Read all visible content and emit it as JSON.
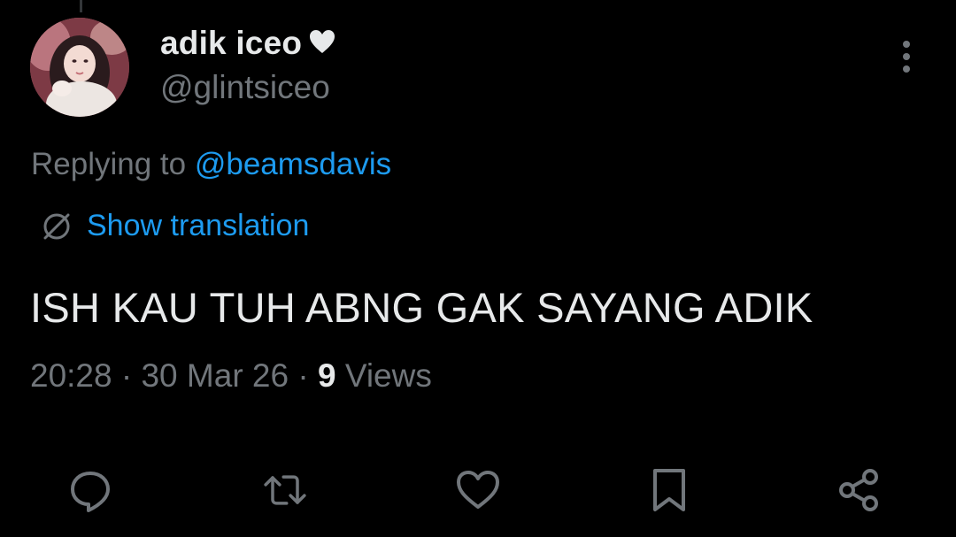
{
  "tweet": {
    "author": {
      "display_name": "adik iceo",
      "handle": "@glintsiceo",
      "name_emoji": "heart-icon"
    },
    "replying": {
      "prefix": "Replying to",
      "mention": "@beamsdavis"
    },
    "translation_label": "Show translation",
    "text": "ISH KAU TUH ABNG GAK SAYANG ADIK",
    "time": "20:28",
    "separator": "·",
    "date": "30 Mar 26",
    "views_count": "9",
    "views_label": "Views"
  },
  "actions": {
    "reply": "reply-icon",
    "retweet": "retweet-icon",
    "like": "heart-outline-icon",
    "bookmark": "bookmark-icon",
    "share": "share-icon"
  },
  "colors": {
    "background": "#000000",
    "primary_text": "#e7e9ea",
    "secondary_text": "#71767b",
    "accent": "#1d9bf0"
  }
}
